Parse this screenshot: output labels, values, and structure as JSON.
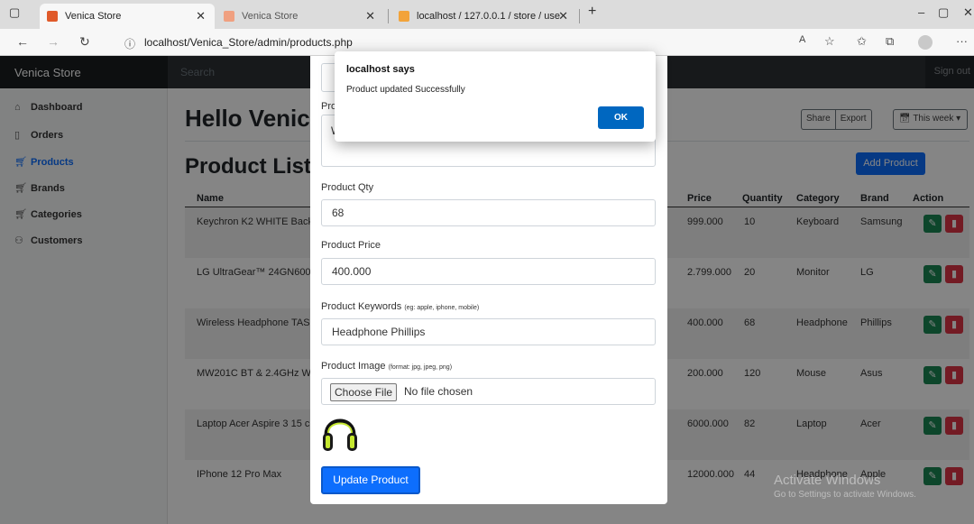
{
  "browser": {
    "tabs": [
      {
        "title": "Venica Store",
        "active": true
      },
      {
        "title": "Venica Store",
        "active": false
      },
      {
        "title": "localhost / 127.0.0.1 / store / use",
        "active": false
      }
    ],
    "new_tab": "+",
    "url": "localhost/Venica_Store/admin/products.php"
  },
  "app": {
    "brand": "Venica Store",
    "search_placeholder": "Search",
    "signout": "Sign out"
  },
  "sidebar": {
    "items": [
      {
        "label": "Dashboard",
        "icon": "home-icon"
      },
      {
        "label": "Orders",
        "icon": "file-icon"
      },
      {
        "label": "Products",
        "icon": "cart-icon",
        "active": true
      },
      {
        "label": "Brands",
        "icon": "cart-icon"
      },
      {
        "label": "Categories",
        "icon": "cart-icon"
      },
      {
        "label": "Customers",
        "icon": "users-icon"
      }
    ]
  },
  "main": {
    "greeting": "Hello Venica",
    "toolbar": {
      "share": "Share",
      "export": "Export",
      "week": "This week"
    },
    "section_title": "Product List",
    "add_button": "Add Product",
    "columns": [
      "Name",
      "Price",
      "Quantity",
      "Category",
      "Brand",
      "Action"
    ],
    "rows": [
      {
        "name": "Keychron K2 WHITE Backl",
        "price": "999.000",
        "quantity": "10",
        "category": "Keyboard",
        "brand": "Samsung"
      },
      {
        "name": "LG UltraGear™ 24GN600-",
        "price": "2.799.000",
        "quantity": "20",
        "category": "Monitor",
        "brand": "LG"
      },
      {
        "name": "Wireless Headphone TASH",
        "price": "400.000",
        "quantity": "68",
        "category": "Headphone",
        "brand": "Phillips"
      },
      {
        "name": "MW201C BT & 2.4GHz Wi",
        "price": "200.000",
        "quantity": "120",
        "category": "Mouse",
        "brand": "Asus"
      },
      {
        "name": "Laptop Acer Aspire 3 15 c",
        "price": "6000.000",
        "quantity": "82",
        "category": "Laptop",
        "brand": "Acer"
      },
      {
        "name": "IPhone 12 Pro Max",
        "price": "12000.000",
        "quantity": "44",
        "category": "Headphone",
        "brand": "Apple"
      }
    ]
  },
  "modal": {
    "desc_label": "Pro",
    "desc_value": "W",
    "qty_label": "Product Qty",
    "qty_value": "68",
    "price_label": "Product Price",
    "price_value": "400.000",
    "keywords_label": "Product Keywords",
    "keywords_hint": "(eg: apple, iphone, mobile)",
    "keywords_value": "Headphone Phillips",
    "image_label": "Product Image",
    "image_hint": "(format: jpg, jpeg, png)",
    "choose_file": "Choose File",
    "no_file": "No file chosen",
    "update_button": "Update Product"
  },
  "alert": {
    "title": "localhost says",
    "message": "Product updated Successfully",
    "ok": "OK"
  },
  "watermark": {
    "line1": "Activate Windows",
    "line2": "Go to Settings to activate Windows."
  },
  "colors": {
    "primary": "#0d6efd",
    "edit": "#198754",
    "delete": "#dc3545",
    "nav": "#212529"
  }
}
